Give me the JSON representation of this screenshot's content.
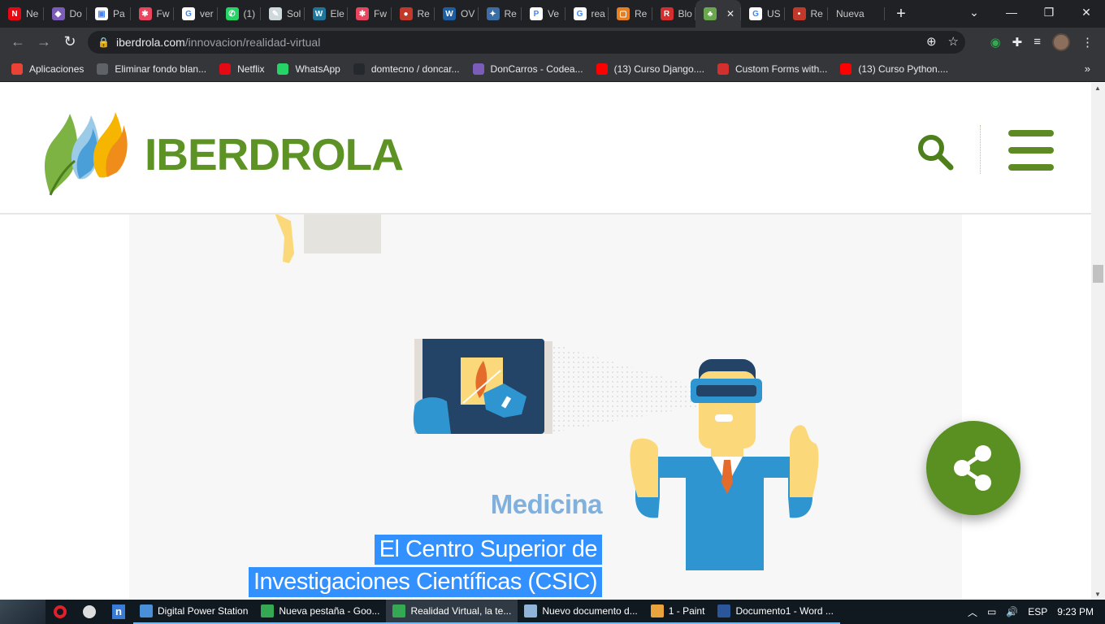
{
  "browser": {
    "tabs": [
      {
        "label": "Ne",
        "icon": "netflix-icon",
        "color": "#e50914",
        "glyph": "N"
      },
      {
        "label": "Do",
        "icon": "cube-icon",
        "color": "#7b5cb8",
        "glyph": "◆"
      },
      {
        "label": "Pa",
        "icon": "page-icon",
        "color": "#ffffff",
        "glyph": "▣"
      },
      {
        "label": "Fw",
        "icon": "fw-icon",
        "color": "#e8455f",
        "glyph": "✱"
      },
      {
        "label": "ver",
        "icon": "google-icon",
        "color": "#ffffff",
        "glyph": "G"
      },
      {
        "label": "(1)",
        "icon": "whatsapp-icon",
        "color": "#25d366",
        "glyph": "✆"
      },
      {
        "label": "Sol",
        "icon": "doc-icon",
        "color": "#cfd8dc",
        "glyph": "✎"
      },
      {
        "label": "Ele",
        "icon": "wordpress-icon",
        "color": "#21759b",
        "glyph": "W"
      },
      {
        "label": "Fw",
        "icon": "fw-icon",
        "color": "#e8455f",
        "glyph": "✱"
      },
      {
        "label": "Re",
        "icon": "circle-icon",
        "color": "#c0392b",
        "glyph": "●"
      },
      {
        "label": "OV",
        "icon": "ov-icon",
        "color": "#1f5f9f",
        "glyph": "W"
      },
      {
        "label": "Re",
        "icon": "gear-icon",
        "color": "#3b6ea5",
        "glyph": "✦"
      },
      {
        "label": "Ve",
        "icon": "p-icon",
        "color": "#ffffff",
        "glyph": "P"
      },
      {
        "label": "rea",
        "icon": "google-icon",
        "color": "#ffffff",
        "glyph": "G"
      },
      {
        "label": "Re",
        "icon": "frame-icon",
        "color": "#e67e22",
        "glyph": "▢"
      },
      {
        "label": "Blo",
        "icon": "blog-icon",
        "color": "#d32f2f",
        "glyph": "R"
      },
      {
        "label": "",
        "icon": "iberdrola-icon",
        "color": "#6aa84f",
        "glyph": "♣",
        "active": true
      },
      {
        "label": "US",
        "icon": "google-icon",
        "color": "#ffffff",
        "glyph": "G"
      },
      {
        "label": "Re",
        "icon": "dot-icon",
        "color": "#c0392b",
        "glyph": "•"
      },
      {
        "label": "Nueva",
        "icon": "",
        "color": "",
        "glyph": ""
      }
    ],
    "url_host": "iberdrola.com",
    "url_path": "/innovacion/realidad-virtual",
    "bookmarks": [
      {
        "label": "Aplicaciones",
        "icon": "apps-grid-icon",
        "color": "#ea4335"
      },
      {
        "label": "Eliminar fondo blan...",
        "icon": "globe-icon",
        "color": "#5f6368"
      },
      {
        "label": "Netflix",
        "icon": "netflix-icon",
        "color": "#e50914"
      },
      {
        "label": "WhatsApp",
        "icon": "whatsapp-icon",
        "color": "#25d366"
      },
      {
        "label": "domtecno / doncar...",
        "icon": "github-icon",
        "color": "#24292e"
      },
      {
        "label": "DonCarros - Codea...",
        "icon": "cube-icon",
        "color": "#7b5cb8"
      },
      {
        "label": "(13) Curso Django....",
        "icon": "youtube-icon",
        "color": "#ff0000"
      },
      {
        "label": "Custom Forms with...",
        "icon": "bookmark-icon",
        "color": "#d32f2f"
      },
      {
        "label": "(13) Curso Python....",
        "icon": "youtube-icon",
        "color": "#ff0000"
      }
    ]
  },
  "site": {
    "logo_text": "IBERDROLA",
    "brand_green": "#5d9224",
    "section_title": "Medicina",
    "headline_line1": "El Centro Superior de",
    "headline_line2": "Investigaciones Científicas (CSIC)"
  },
  "taskbar": {
    "apps": [
      {
        "label": "Digital Power Station",
        "icon": "power-station-icon",
        "color": "#4a90d9"
      },
      {
        "label": "Nueva pestaña - Goo...",
        "icon": "chrome-icon",
        "color": "#34a853"
      },
      {
        "label": "Realidad Virtual, la te...",
        "icon": "chrome-icon",
        "color": "#34a853",
        "active": true
      },
      {
        "label": "Nuevo documento d...",
        "icon": "notepad-icon",
        "color": "#8fb3d9"
      },
      {
        "label": "1 - Paint",
        "icon": "paint-icon",
        "color": "#e8a33c"
      },
      {
        "label": "Documento1 - Word ...",
        "icon": "word-icon",
        "color": "#2b579a"
      }
    ],
    "lang": "ESP",
    "time": "9:23 PM"
  }
}
